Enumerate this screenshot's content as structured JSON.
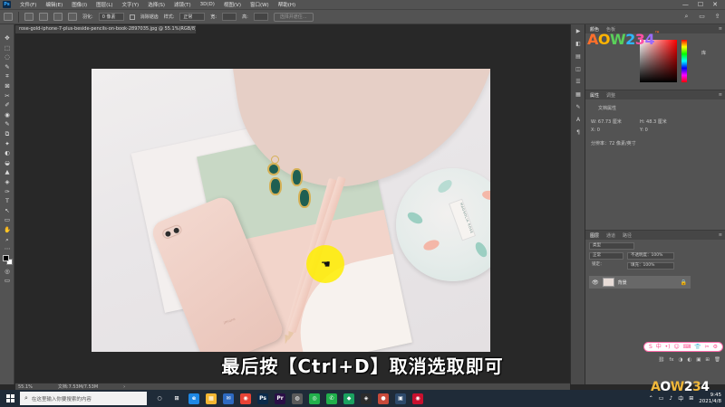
{
  "menubar": {
    "logo": "Ps",
    "items": [
      "文件(F)",
      "编辑(E)",
      "图像(I)",
      "图层(L)",
      "文字(Y)",
      "选择(S)",
      "滤镜(T)",
      "3D(D)",
      "视图(V)",
      "窗口(W)",
      "帮助(H)"
    ],
    "minimize": "—",
    "maximize": "☐",
    "close": "✕"
  },
  "options": {
    "feather_label": "羽化:",
    "feather_value": "0 像素",
    "mode_select": "正常",
    "width_label": "宽度:",
    "anti_alias": "消除锯齿",
    "style_label": "样式:",
    "style_value": "正常",
    "select_mask_btn": "选择并遮住...",
    "height_label": "高度:",
    "width_short": "宽:",
    "height_short": "高:"
  },
  "toolbar": {
    "tools": [
      "✥",
      "⬚",
      "◌",
      "✎",
      "⌗",
      "⊠",
      "✂",
      "✐",
      "◉",
      "✎",
      "⧉",
      "✦",
      "◐",
      "◒",
      "▲",
      "◈",
      "✑",
      "T",
      "↖",
      "▭",
      "✋",
      "⌕",
      "⋯"
    ],
    "foreground_color": "#000000",
    "background_color": "#ffffff"
  },
  "document": {
    "tab_title": "rose-gold-iphone-7-plus-beside-pencils-on-book-2897035.jpg @ 55.1%(RGB/8)",
    "tab_close": "×",
    "phone_logo": "",
    "phone_brand": "iPhone",
    "tin_text": "MAGNOLIA ROSE"
  },
  "panels": {
    "color_tabs": [
      "颜色",
      "色板"
    ],
    "library_label": "库",
    "properties_tabs": [
      "属性",
      "调整"
    ],
    "properties_header": "文档属性",
    "props": {
      "width": "W:  67.73 厘米",
      "height": "H:  48.3 厘米",
      "x": "X:  0",
      "y": "Y:  0",
      "resolution": "分辨率：72 像素/英寸"
    },
    "layers_tabs": [
      "图层",
      "通道",
      "路径"
    ],
    "layer_kind": "类型",
    "blend_mode": "正常",
    "opacity": "不透明度：100%",
    "lock_label": "锁定：",
    "fill": "填充：100%",
    "layer_name": "背景",
    "eye": "👁",
    "lock_icon": "🔒",
    "footer_icons": [
      "⛓",
      "fx",
      "◑",
      "◐",
      "▣",
      "⊞",
      "🗑"
    ]
  },
  "dock_icons": [
    "▶",
    "◧",
    "▤",
    "◫",
    "☰",
    "▦",
    "✎",
    "A",
    "¶"
  ],
  "watermark": [
    "A",
    "O",
    "W",
    "2",
    "3",
    "4",
    "™"
  ],
  "watermark2": [
    "A",
    "O",
    "W",
    "2",
    "3",
    "4"
  ],
  "subtitle": "最后按【Ctrl+D】取消选取即可",
  "ime_bar": [
    "S",
    "中",
    "•)",
    "☺",
    "⌨",
    "👕",
    "✂",
    "⚙"
  ],
  "statusbar": {
    "zoom": "55.1%",
    "doc_info": "文档:7.53M/7.53M",
    "arrow": "›"
  },
  "taskbar": {
    "search_placeholder": "在这里输入你要搜索的内容",
    "apps": [
      {
        "label": "○",
        "color": "transparent"
      },
      {
        "label": "⊞",
        "color": "transparent"
      },
      {
        "label": "e",
        "color": "#1e88e5"
      },
      {
        "label": "▦",
        "color": "#f2b632"
      },
      {
        "label": "✉",
        "color": "#2d6ac2"
      },
      {
        "label": "◉",
        "color": "#e94335"
      },
      {
        "label": "Ps",
        "color": "#0b2a4a"
      },
      {
        "label": "Pr",
        "color": "#2a0f46"
      },
      {
        "label": "◍",
        "color": "#5a5a5a"
      },
      {
        "label": "◎",
        "color": "#21b04b"
      },
      {
        "label": "✆",
        "color": "#21b04b"
      },
      {
        "label": "◆",
        "color": "#1aa260"
      },
      {
        "label": "◈",
        "color": "#2b2b2b"
      },
      {
        "label": "●",
        "color": "#c94a3b"
      },
      {
        "label": "▣",
        "color": "#2e4a6b"
      },
      {
        "label": "◉",
        "color": "#c8102e"
      }
    ],
    "tray": [
      "⌃",
      "▭",
      "♪",
      "中",
      "⊞"
    ],
    "time": "9:45",
    "date": "2021/4/8"
  }
}
